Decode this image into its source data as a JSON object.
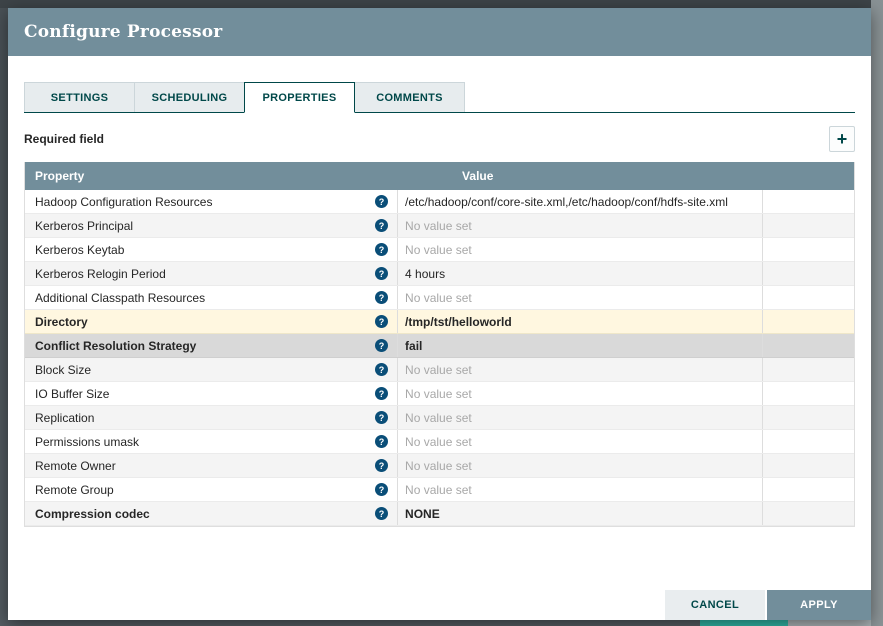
{
  "colors": {
    "header": "#728e9b",
    "accent": "#004849",
    "help": "#0a4e78",
    "row-modified": "#fff7e0",
    "row-selected": "#d9d9d9",
    "apply-bg": "#728e9b",
    "cancel-bg": "#e9edef"
  },
  "dialog": {
    "title": "Configure Processor",
    "tabs": [
      {
        "label": "SETTINGS",
        "active": false
      },
      {
        "label": "SCHEDULING",
        "active": false
      },
      {
        "label": "PROPERTIES",
        "active": true
      },
      {
        "label": "COMMENTS",
        "active": false
      }
    ],
    "toolbar": {
      "required_field_label": "Required field",
      "add_button_label": "+"
    },
    "table": {
      "help_icon_glyph": "?",
      "columns": {
        "property": "Property",
        "value": "Value"
      },
      "no_value_text": "No value set",
      "rows": [
        {
          "property": "Hadoop Configuration Resources",
          "value": "/etc/hadoop/conf/core-site.xml,/etc/hadoop/conf/hdfs-site.xml",
          "value_set": true,
          "bold": false,
          "bg": "auto"
        },
        {
          "property": "Kerberos Principal",
          "value": "No value set",
          "value_set": false,
          "bold": false,
          "bg": "auto"
        },
        {
          "property": "Kerberos Keytab",
          "value": "No value set",
          "value_set": false,
          "bold": false,
          "bg": "auto"
        },
        {
          "property": "Kerberos Relogin Period",
          "value": "4 hours",
          "value_set": true,
          "bold": false,
          "bg": "auto"
        },
        {
          "property": "Additional Classpath Resources",
          "value": "No value set",
          "value_set": false,
          "bold": false,
          "bg": "auto"
        },
        {
          "property": "Directory",
          "value": "/tmp/tst/helloworld",
          "value_set": true,
          "bold": true,
          "bg": "modified"
        },
        {
          "property": "Conflict Resolution Strategy",
          "value": "fail",
          "value_set": true,
          "bold": true,
          "bg": "selected"
        },
        {
          "property": "Block Size",
          "value": "No value set",
          "value_set": false,
          "bold": false,
          "bg": "auto"
        },
        {
          "property": "IO Buffer Size",
          "value": "No value set",
          "value_set": false,
          "bold": false,
          "bg": "auto"
        },
        {
          "property": "Replication",
          "value": "No value set",
          "value_set": false,
          "bold": false,
          "bg": "auto"
        },
        {
          "property": "Permissions umask",
          "value": "No value set",
          "value_set": false,
          "bold": false,
          "bg": "auto"
        },
        {
          "property": "Remote Owner",
          "value": "No value set",
          "value_set": false,
          "bold": false,
          "bg": "auto"
        },
        {
          "property": "Remote Group",
          "value": "No value set",
          "value_set": false,
          "bold": false,
          "bg": "auto"
        },
        {
          "property": "Compression codec",
          "value": "NONE",
          "value_set": true,
          "bold": true,
          "bg": "auto"
        }
      ]
    },
    "footer": {
      "cancel_label": "CANCEL",
      "apply_label": "APPLY"
    }
  }
}
